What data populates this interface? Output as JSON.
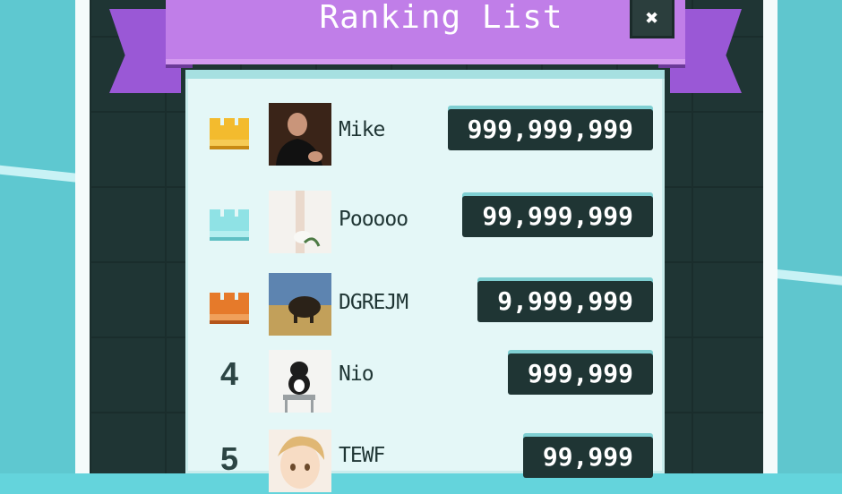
{
  "dialog": {
    "title": "Ranking List",
    "close_icon": "close-icon"
  },
  "colors": {
    "ribbon": "#c07ee8",
    "panel": "#1f3534",
    "sheet": "#e4f7f7",
    "gold": "#f0b830",
    "silver": "#8ee3e6",
    "bronze": "#e67a2a"
  },
  "ranking": [
    {
      "rank": "1",
      "medal": "gold-crown-icon",
      "name": "Mike",
      "score": "999,999,999"
    },
    {
      "rank": "2",
      "medal": "silver-crown-icon",
      "name": "Pooooo",
      "score": "99,999,999"
    },
    {
      "rank": "3",
      "medal": "bronze-crown-icon",
      "name": "DGREJM",
      "score": "9,999,999"
    },
    {
      "rank": "4",
      "medal": "",
      "name": "Nio",
      "score": "999,999"
    },
    {
      "rank": "5",
      "medal": "",
      "name": "TEWF",
      "score": "99,999"
    }
  ]
}
